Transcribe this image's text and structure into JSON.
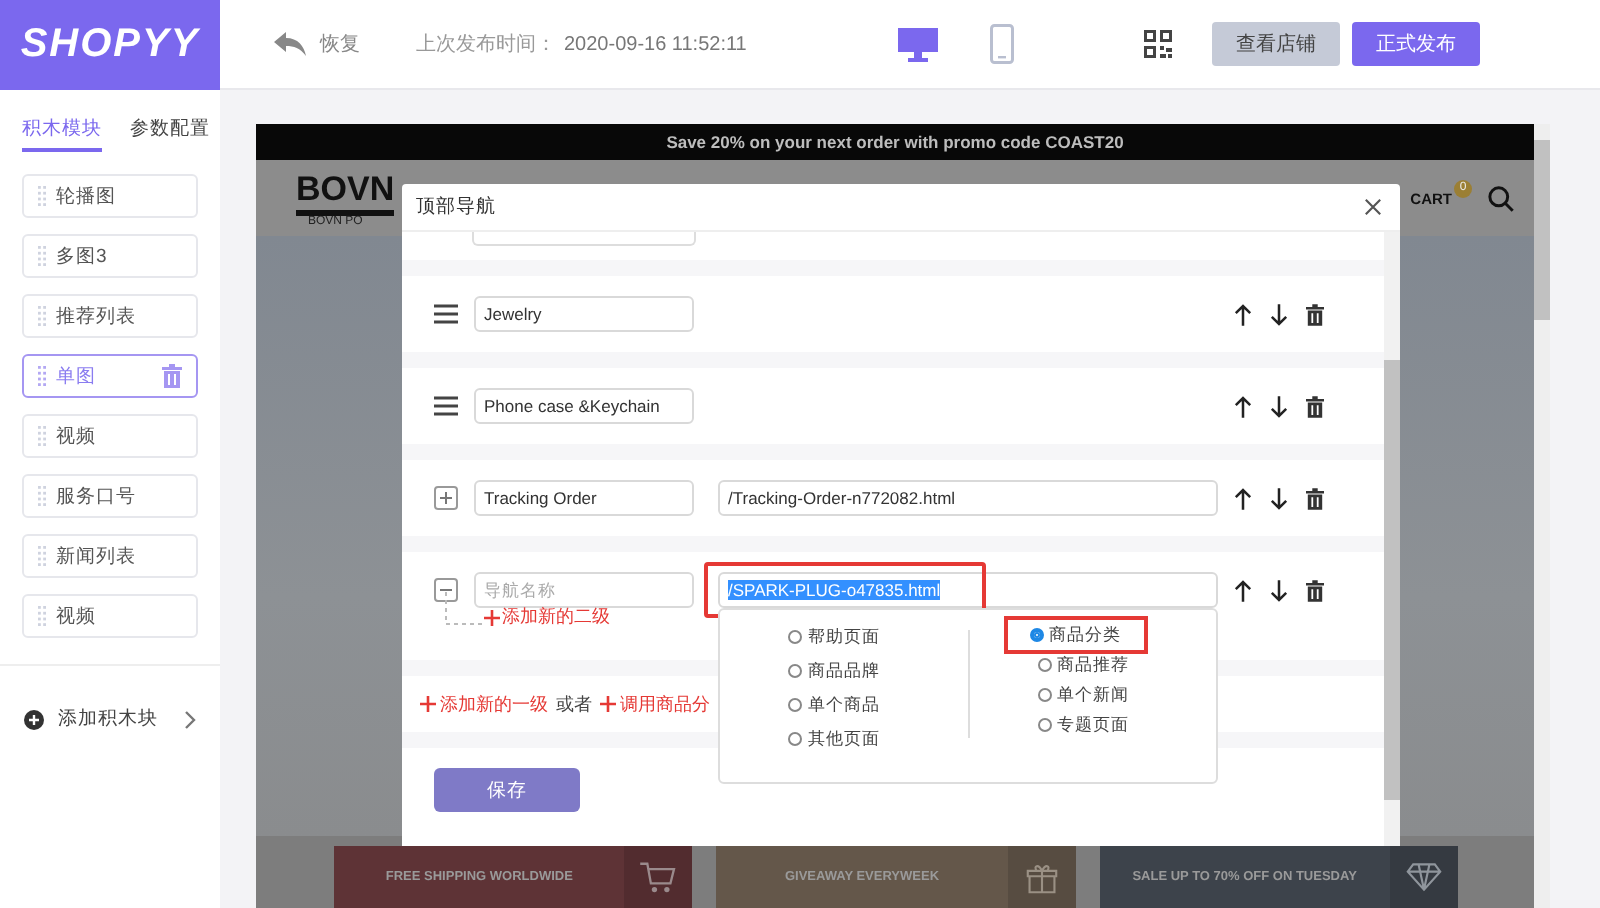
{
  "header": {
    "logo": "SHOPYY",
    "undo_label": "恢复",
    "publish_time_label": "上次发布时间：",
    "publish_time": "2020-09-16 11:52:11",
    "devices": [
      {
        "kind": "desktop",
        "selected": true
      },
      {
        "kind": "mobile",
        "selected": false
      }
    ],
    "buttons": [
      {
        "label": "查看店铺",
        "kind": "secondary"
      },
      {
        "label": "正式发布",
        "kind": "primary"
      }
    ]
  },
  "sidebar": {
    "tabs": [
      {
        "label": "积木模块",
        "selected": true
      },
      {
        "label": "参数配置",
        "selected": false
      }
    ],
    "blocks": [
      {
        "label": "轮播图",
        "selected": false
      },
      {
        "label": "多图3",
        "selected": false
      },
      {
        "label": "推荐列表",
        "selected": false
      },
      {
        "label": "单图",
        "selected": true
      },
      {
        "label": "视频",
        "selected": false
      },
      {
        "label": "服务口号",
        "selected": false
      },
      {
        "label": "新闻列表",
        "selected": false
      },
      {
        "label": "视频",
        "selected": false
      }
    ],
    "add_block": "添加积木块"
  },
  "preview": {
    "promo": "Save 20% on your next order with promo code COAST20",
    "logo": "BOVN",
    "logo_sub": "BOVN PO",
    "cart": "CART",
    "cart_count": "0",
    "banners": [
      {
        "text": "FREE SHIPPING WORLDWIDE",
        "kind": "cart",
        "color": "#5e3336"
      },
      {
        "text": "GIVEAWAY EVERYWEEK",
        "kind": "gift",
        "color": "#64574a"
      },
      {
        "text": "SALE UP TO 70% OFF ON TUESDAY",
        "kind": "diamond",
        "color": "#3d434b"
      }
    ]
  },
  "modal": {
    "title": "顶部导航",
    "nav_items": [
      {
        "kind": "menu",
        "name": "Jewelry"
      },
      {
        "kind": "menu",
        "name": "Phone case &Keychain"
      },
      {
        "kind": "tree",
        "expanded": false,
        "name": "Tracking Order",
        "url": "/Tracking-Order-n772082.html",
        "url_selected": false,
        "highlighted": false
      },
      {
        "kind": "tree",
        "expanded": true,
        "name_placeholder": "导航名称",
        "url": "/SPARK-PLUG-o47835.html",
        "url_selected": true,
        "highlighted": true,
        "add_child": "添加新的二级",
        "link_types": [
          [
            {
              "label": "帮助页面",
              "selected": false
            },
            {
              "label": "商品品牌",
              "selected": false
            },
            {
              "label": "单个商品",
              "selected": false
            },
            {
              "label": "其他页面",
              "selected": false
            }
          ],
          [
            {
              "label": "商品分类",
              "selected": true
            },
            {
              "label": "商品推荐",
              "selected": false
            },
            {
              "label": "单个新闻",
              "selected": false
            },
            {
              "label": "专题页面",
              "selected": false
            }
          ]
        ]
      }
    ],
    "add_top_level": "添加新的一级",
    "or": "或者",
    "use_category": "调用商品分",
    "save": "保存"
  }
}
